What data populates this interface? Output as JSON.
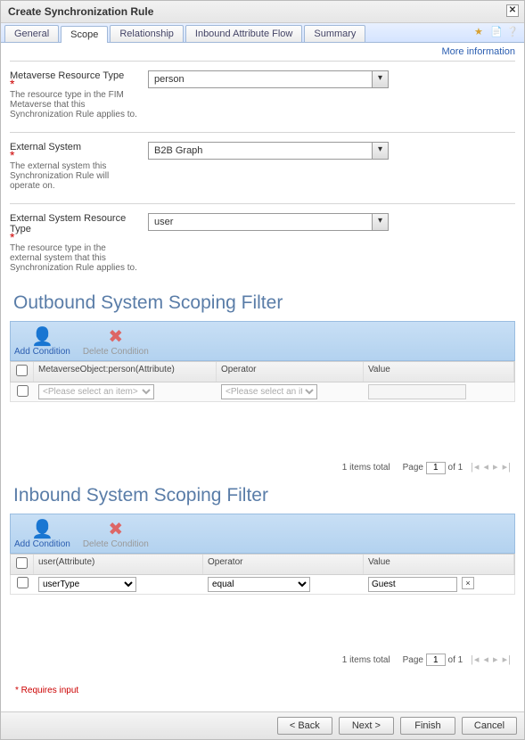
{
  "title": "Create Synchronization Rule",
  "tabs": [
    "General",
    "Scope",
    "Relationship",
    "Inbound Attribute Flow",
    "Summary"
  ],
  "active_tab": 1,
  "more_info": "More information",
  "fields": {
    "metaverse": {
      "label": "Metaverse Resource Type",
      "desc": "The resource type in the FIM Metaverse that this Synchronization Rule applies to.",
      "value": "person"
    },
    "external_system": {
      "label": "External System",
      "desc": "The external system this Synchronization Rule will operate on.",
      "value": "B2B Graph"
    },
    "external_type": {
      "label": "External System Resource Type",
      "desc": "The resource type in the external system that this Synchronization Rule applies to.",
      "value": "user"
    }
  },
  "outbound": {
    "title": "Outbound System Scoping Filter",
    "add": "Add Condition",
    "del": "Delete Condition",
    "headers": {
      "attr": "MetaverseObject:person(Attribute)",
      "op": "Operator",
      "val": "Value"
    },
    "row": {
      "attr_placeholder": "<Please select an item>",
      "op_placeholder": "<Please select an item>"
    },
    "pager": {
      "total": "1 items total",
      "page_label": "Page",
      "of": "of 1",
      "page": "1"
    }
  },
  "inbound": {
    "title": "Inbound System Scoping Filter",
    "add": "Add Condition",
    "del": "Delete Condition",
    "headers": {
      "attr": "user(Attribute)",
      "op": "Operator",
      "val": "Value"
    },
    "row": {
      "attr": "userType",
      "op": "equal",
      "val": "Guest"
    },
    "pager": {
      "total": "1 items total",
      "page_label": "Page",
      "of": "of 1",
      "page": "1"
    }
  },
  "requires_note": "* Requires input",
  "buttons": {
    "back": "< Back",
    "next": "Next >",
    "finish": "Finish",
    "cancel": "Cancel"
  }
}
